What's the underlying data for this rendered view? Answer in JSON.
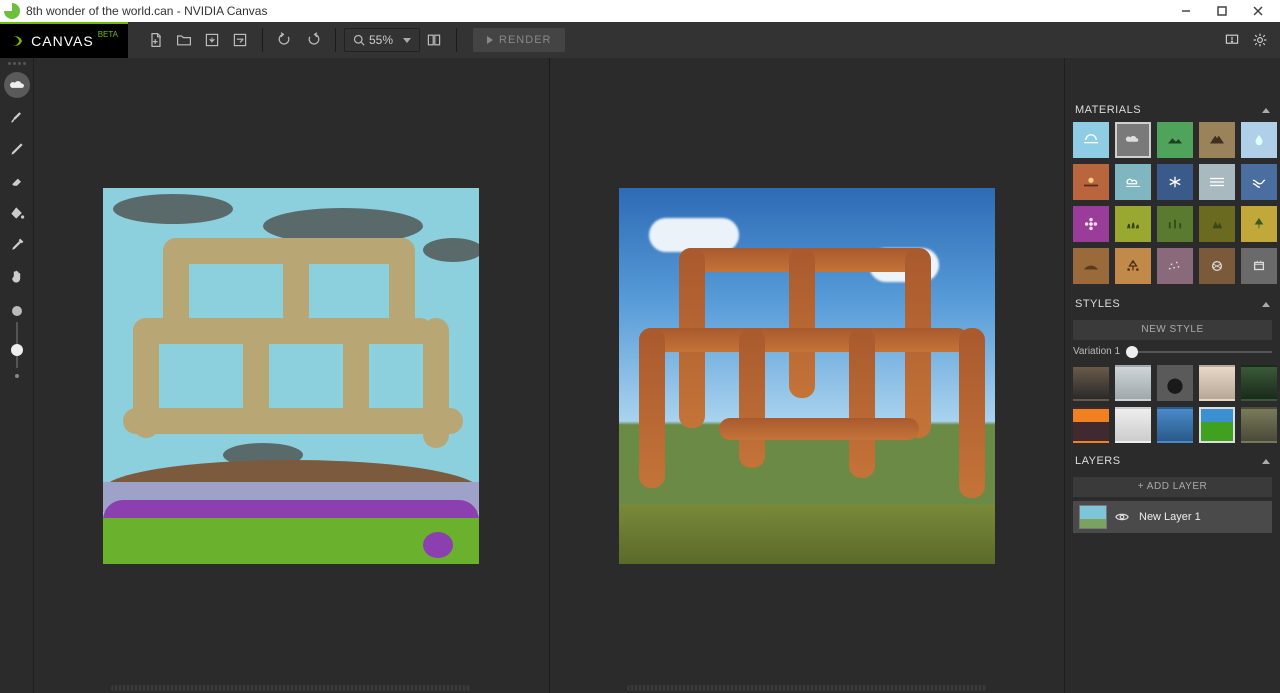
{
  "window": {
    "title": "8th wonder of the world.can - NVIDIA Canvas"
  },
  "brand": {
    "name": "CANVAS",
    "tag": "BETA"
  },
  "toolbar": {
    "zoom": "55%",
    "render": "RENDER"
  },
  "panels": {
    "materials": {
      "title": "MATERIALS"
    },
    "styles": {
      "title": "STYLES",
      "newBtn": "NEW STYLE",
      "variation": "Variation 1"
    },
    "layers": {
      "title": "LAYERS",
      "addBtn": "+ ADD LAYER",
      "layer1": "New Layer 1"
    }
  },
  "materials": [
    {
      "name": "sky",
      "bg": "#8fcde4",
      "selected": false
    },
    {
      "name": "cloud",
      "bg": "#7a7a7a",
      "selected": true
    },
    {
      "name": "hill",
      "bg": "#4fa35a",
      "selected": false
    },
    {
      "name": "mountain",
      "bg": "#9a835b",
      "selected": false
    },
    {
      "name": "water",
      "bg": "#b0cfe8",
      "selected": false
    },
    {
      "name": "fog",
      "bg": "#b9663e",
      "selected": false
    },
    {
      "name": "sea",
      "bg": "#7fb6bf",
      "selected": false
    },
    {
      "name": "snow",
      "bg": "#3a5a8a",
      "selected": false
    },
    {
      "name": "haze",
      "bg": "#a8b9c0",
      "selected": false
    },
    {
      "name": "river",
      "bg": "#4a6ea0",
      "selected": false
    },
    {
      "name": "flower",
      "bg": "#9a3d9a",
      "selected": false
    },
    {
      "name": "grass",
      "bg": "#98a830",
      "selected": false
    },
    {
      "name": "bush",
      "bg": "#5a7a2f",
      "selected": false
    },
    {
      "name": "moss",
      "bg": "#6a6a20",
      "selected": false
    },
    {
      "name": "tree",
      "bg": "#c2a83a",
      "selected": false
    },
    {
      "name": "dirt",
      "bg": "#9a6a3a",
      "selected": false
    },
    {
      "name": "sand",
      "bg": "#c28a4a",
      "selected": false
    },
    {
      "name": "gravel",
      "bg": "#8a6a7a",
      "selected": false
    },
    {
      "name": "rock",
      "bg": "#7a5a3a",
      "selected": false
    },
    {
      "name": "stone",
      "bg": "#6a6a6a",
      "selected": false
    }
  ],
  "styleThumbs": [
    {
      "name": "st1",
      "bg": "linear-gradient(#6a5a4a,#2a2a2a)"
    },
    {
      "name": "st2",
      "bg": "linear-gradient(#cfd5d8,#a0a8ab)"
    },
    {
      "name": "st3",
      "bg": "radial-gradient(circle at 50% 60%,#1a1a1a 30%,#5a5a5a 31%)"
    },
    {
      "name": "st4",
      "bg": "linear-gradient(#e8d8c8,#b8a898)"
    },
    {
      "name": "st5",
      "bg": "linear-gradient(#3a5a3a,#1a2a1a)"
    },
    {
      "name": "st6",
      "bg": "linear-gradient(#f08020 40%,#402a30 41%)"
    },
    {
      "name": "st7",
      "bg": "linear-gradient(#eee,#ccc)"
    },
    {
      "name": "st8",
      "bg": "linear-gradient(#4a8ac8,#2a5a8a)"
    },
    {
      "name": "st9",
      "bg": "linear-gradient(#3a90d0 40%,#40a020 41%)",
      "selected": true
    },
    {
      "name": "st10",
      "bg": "linear-gradient(#7a7a5a,#4a4a3a)"
    }
  ]
}
